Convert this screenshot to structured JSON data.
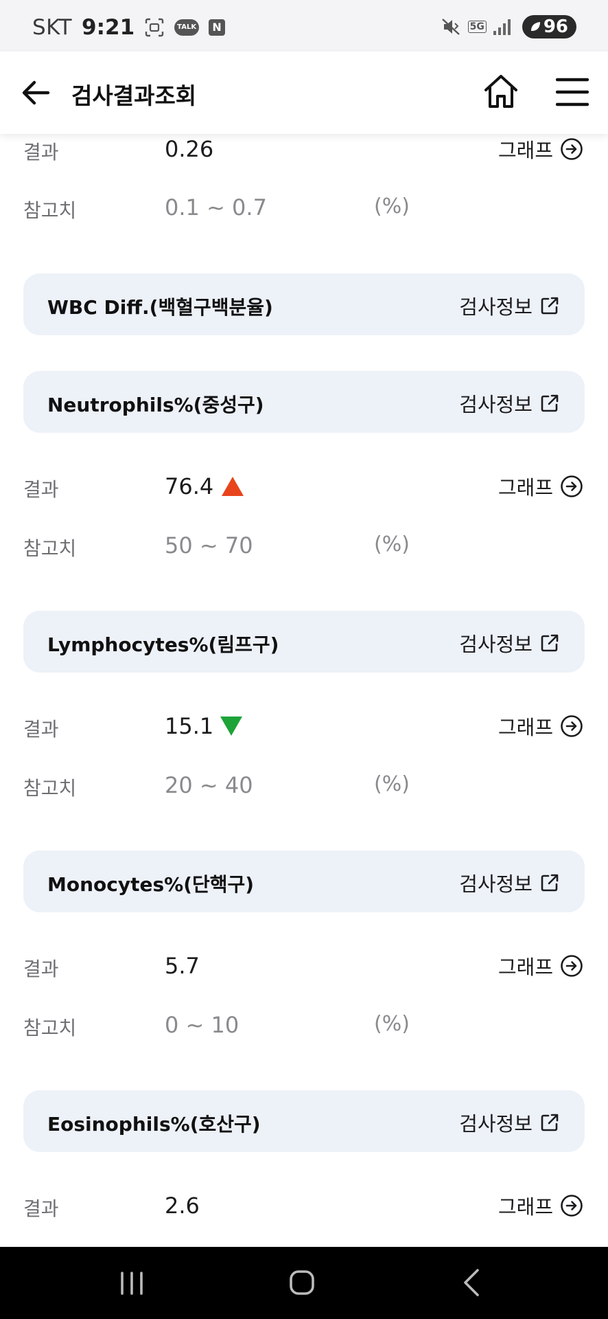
{
  "status_bar": {
    "carrier": "SKT",
    "time": "9:21",
    "talk_badge": "TALK",
    "n_badge": "N",
    "network": "5G",
    "battery": "96"
  },
  "header": {
    "title": "검사결과조회"
  },
  "labels": {
    "result": "결과",
    "reference": "참고치",
    "graph": "그래프",
    "info": "검사정보"
  },
  "top_item": {
    "result": "0.26",
    "reference": "0.1 ~ 0.7",
    "unit": "(%)"
  },
  "section": {
    "name": "WBC Diff.(백혈구백분율)"
  },
  "tests": [
    {
      "name": "Neutrophils%(중성구)",
      "result": "76.4",
      "flag": "high",
      "reference": "50 ~ 70",
      "unit": "(%)"
    },
    {
      "name": "Lymphocytes%(림프구)",
      "result": "15.1",
      "flag": "low",
      "reference": "20 ~ 40",
      "unit": "(%)"
    },
    {
      "name": "Monocytes%(단핵구)",
      "result": "5.7",
      "flag": "normal",
      "reference": "0 ~ 10",
      "unit": "(%)"
    },
    {
      "name": "Eosinophils%(호산구)",
      "result": "2.6",
      "flag": "normal"
    }
  ],
  "colors": {
    "card_bg": "#edf1f8",
    "high": "#e8441c",
    "low": "#1ea339"
  }
}
